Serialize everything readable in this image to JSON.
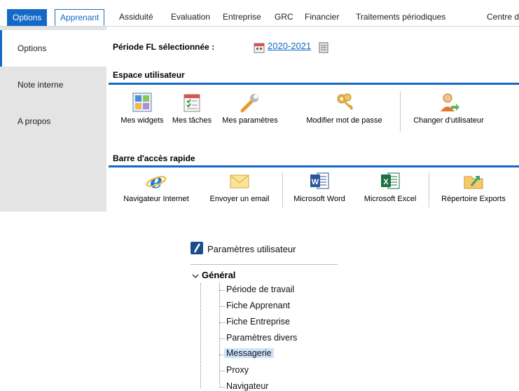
{
  "menubar": {
    "tabs": [
      "Options",
      "Apprenant",
      "Assiduité",
      "Evaluation",
      "Entreprise",
      "GRC",
      "Financier",
      "Traitements périodiques",
      "Centre d"
    ]
  },
  "sidenav": {
    "items": [
      "Options",
      "Note interne",
      "A propos"
    ]
  },
  "periode": {
    "label": "Période FL sélectionnée :",
    "value": "2020-2021"
  },
  "espace_utilisateur": {
    "title": "Espace utilisateur",
    "tools": [
      {
        "label": "Mes widgets",
        "icon": "widgets-icon"
      },
      {
        "label": "Mes tâches",
        "icon": "tasks-icon"
      },
      {
        "label": "Mes paramètres",
        "icon": "wrench-icon"
      },
      {
        "label": "Modifier mot de passe",
        "icon": "keys-icon"
      },
      {
        "label": "Changer d'utilisateur",
        "icon": "change-user-icon"
      }
    ]
  },
  "barre_acces": {
    "title": "Barre d'accès rapide",
    "tools": [
      {
        "label": "Navigateur Internet",
        "icon": "internet-explorer-icon"
      },
      {
        "label": "Envoyer un email",
        "icon": "envelope-icon"
      },
      {
        "label": "Microsoft Word",
        "icon": "word-icon"
      },
      {
        "label": "Microsoft Excel",
        "icon": "excel-icon"
      },
      {
        "label": "Répertoire Exports",
        "icon": "folder-icon"
      }
    ]
  },
  "tree": {
    "title": "Paramètres utilisateur",
    "root": "Général",
    "items": [
      "Période de travail",
      "Fiche Apprenant",
      "Fiche Entreprise",
      "Paramètres divers",
      "Messagerie",
      "Proxy",
      "Navigateur"
    ],
    "selected": "Messagerie"
  },
  "colors": {
    "accent": "#1469c7",
    "sidebar_bg": "#e4e4e4",
    "selection_bg": "#cce4fb"
  }
}
